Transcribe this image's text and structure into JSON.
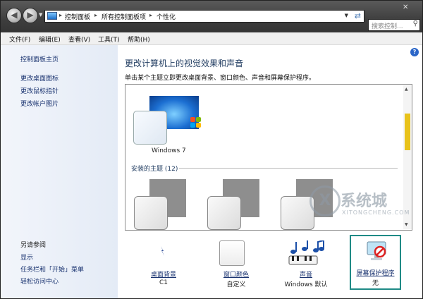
{
  "address_bar": {
    "breadcrumbs": [
      "控制面板",
      "所有控制面板项",
      "个性化"
    ]
  },
  "search": {
    "placeholder": "搜索控制..."
  },
  "menu": {
    "items": [
      "文件(F)",
      "编辑(E)",
      "查看(V)",
      "工具(T)",
      "帮助(H)"
    ]
  },
  "left_pane": {
    "home": "控制面板主页",
    "links": [
      "更改桌面图标",
      "更改鼠标指针",
      "更改帐户图片"
    ],
    "see_also_title": "另请参阅",
    "see_also": [
      "显示",
      "任务栏和「开始」菜单",
      "轻松访问中心"
    ]
  },
  "main": {
    "title": "更改计算机上的视觉效果和声音",
    "subtitle": "单击某个主题立即更改桌面背景、窗口颜色、声音和屏幕保护程序。",
    "current_theme": "Windows 7",
    "installed_label": "安装的主题 (12)"
  },
  "bottom": [
    {
      "link": "桌面背景",
      "value": "C1"
    },
    {
      "link": "窗口颜色",
      "value": "自定义"
    },
    {
      "link": "声音",
      "value": "Windows 默认"
    },
    {
      "link": "屏幕保护程序",
      "value": "无"
    }
  ],
  "watermark": {
    "main": "系统城",
    "sub": "XITONGCHENG.COM"
  },
  "colors": {
    "accent_link": "#1a3370",
    "selected_border": "#1f8a86",
    "scroll_thumb": "#e8c21a"
  }
}
